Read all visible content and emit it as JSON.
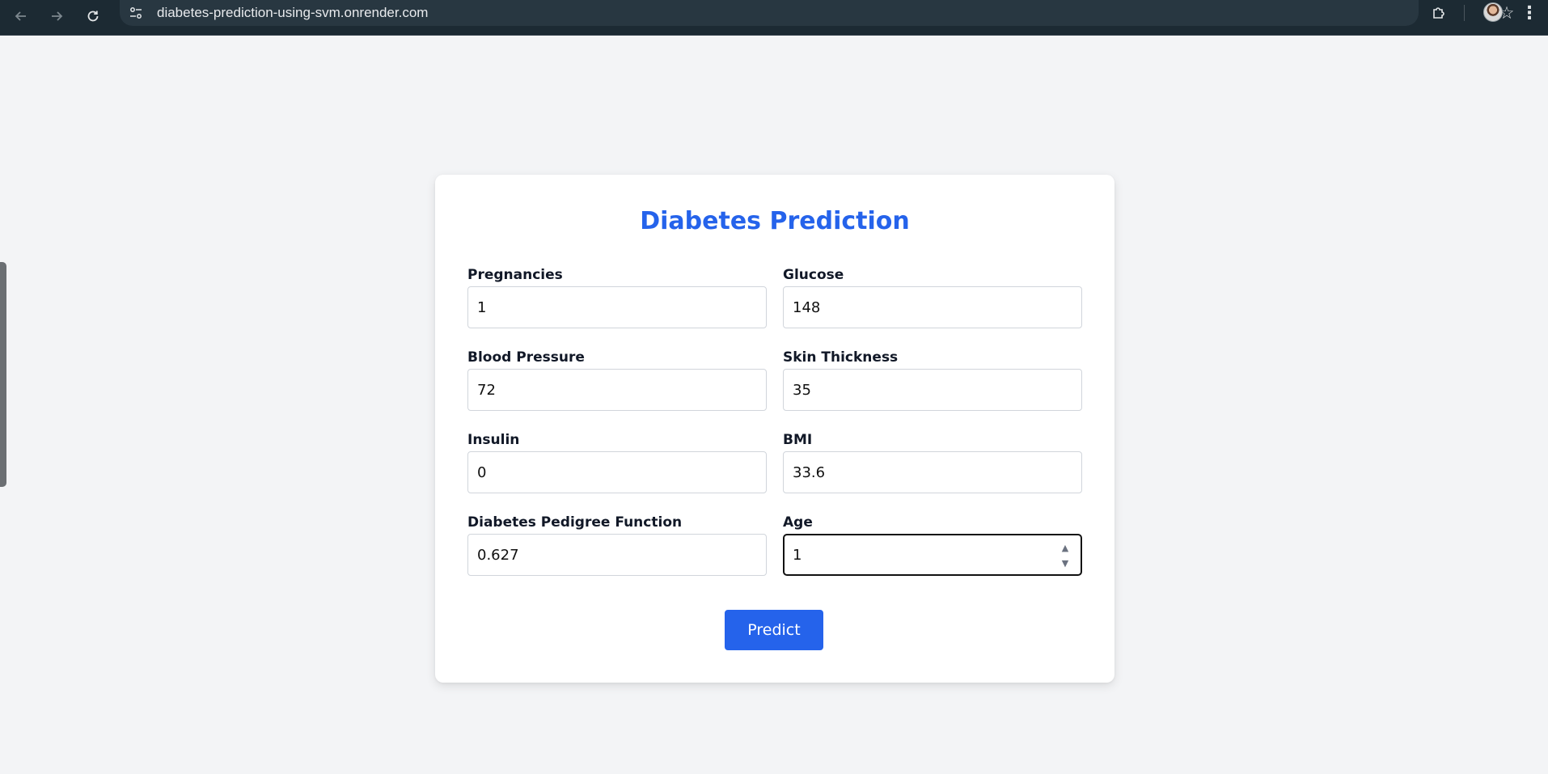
{
  "browser": {
    "url": "diabetes-prediction-using-svm.onrender.com"
  },
  "form": {
    "title": "Diabetes Prediction",
    "fields": [
      {
        "label": "Pregnancies",
        "value": "1"
      },
      {
        "label": "Glucose",
        "value": "148"
      },
      {
        "label": "Blood Pressure",
        "value": "72"
      },
      {
        "label": "Skin Thickness",
        "value": "35"
      },
      {
        "label": "Insulin",
        "value": "0"
      },
      {
        "label": "BMI",
        "value": "33.6"
      },
      {
        "label": "Diabetes Pedigree Function",
        "value": "0.627"
      },
      {
        "label": "Age",
        "value": "1"
      }
    ],
    "submit_label": "Predict"
  },
  "colors": {
    "accent": "#2563eb",
    "page_bg": "#f3f4f6",
    "chrome_bg": "#1c2a33"
  },
  "icons": {
    "back": "arrow-left-icon",
    "forward": "arrow-right-icon",
    "reload": "reload-icon",
    "site_info": "tune-icon",
    "bookmark": "star-icon",
    "extensions": "puzzle-icon",
    "menu": "more-vert-icon"
  }
}
